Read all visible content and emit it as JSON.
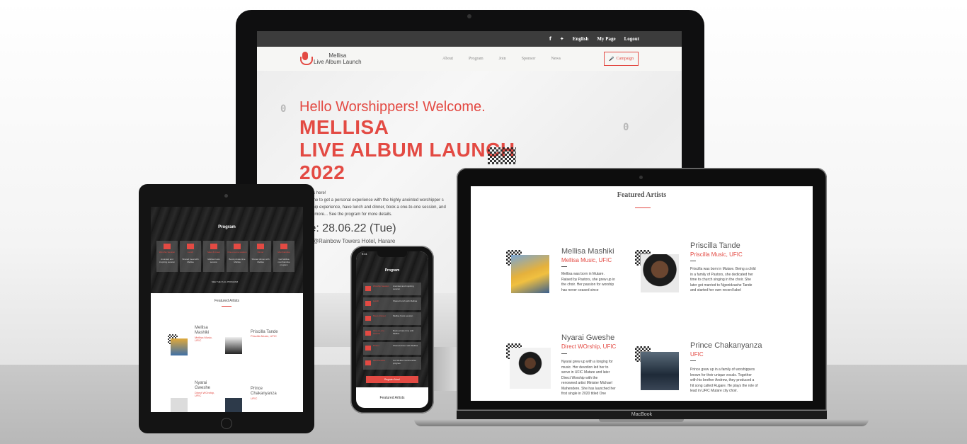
{
  "desktop": {
    "topbar": {
      "facebook_icon": "f",
      "twitter_icon": "🐦",
      "language": "English",
      "my_page": "My Page",
      "logout": "Logout"
    },
    "brand": {
      "line1": "Mellisa",
      "line2": "Live Album Launch",
      "icon": "microphone-icon"
    },
    "nav": [
      "About",
      "Program",
      "Join",
      "Sponsor",
      "News"
    ],
    "campaign_button": "Campaign",
    "hero": {
      "greeting": "Hello Worshippers! Welcome.",
      "title_line1": "MELLISA",
      "title_line2": "LIVE ALBUM LAUNCH",
      "title_line3": "2022",
      "text_line1": "e it's here!",
      "text_line2": "e time to get a personal experience with the highly anointed worshipper s",
      "text_line3": "orship experience, have lunch and dinner, book a one-to-one session, and",
      "text_line4": "uch more... See the program for more details.",
      "date": "te: 28.06.22 (Tue)",
      "venue": "e: @Rainbow Towers Hotel, Harare",
      "counter_left": "0",
      "counter_right": "0"
    }
  },
  "tablet": {
    "program_title": "Program",
    "program_items": [
      {
        "label": "Worship Session",
        "text": "Anointed and inspiring session"
      },
      {
        "label": "Lunch",
        "text": "Shared meal with Mellisa"
      },
      {
        "label": "Meet & Greet",
        "text": "Mellisa hosts session"
      },
      {
        "label": "One-on-one session",
        "text": "Book private time Mellisa"
      },
      {
        "label": "Dinner",
        "text": "Shared dinner with Mellisa"
      },
      {
        "label": "Merchandise",
        "text": "Get Mellisa merchandise program"
      }
    ],
    "program_note": "SEE THE FULL PROGRAM",
    "featured_title": "Featured Artists",
    "artists": [
      {
        "name1": "Mellisa",
        "name2": "Mashiki",
        "role1": "Mellisa Music,",
        "role2": "UFIC"
      },
      {
        "name1": "Priscilla Tande",
        "name2": "",
        "role1": "Priscilla Music, UFIC",
        "role2": ""
      },
      {
        "name1": "Nyarai",
        "name2": "Gweshe",
        "role1": "Direct WOrship,",
        "role2": "UFIC"
      },
      {
        "name1": "Prince",
        "name2": "Chakanyanza",
        "role1": "UFIC",
        "role2": ""
      }
    ]
  },
  "phone": {
    "time": "9:41",
    "program_title": "Program",
    "program_items": [
      {
        "label": "Worship Session",
        "text": "Anointed and inspiring session"
      },
      {
        "label": "Lunch",
        "text": "Shared lunch with Mellisa"
      },
      {
        "label": "Meet & Greet",
        "text": "Mellisa hosts session"
      },
      {
        "label": "One-on-one session",
        "text": "Book private time with Mellisa"
      },
      {
        "label": "Dinner",
        "text": "Shared dinner with Mellisa"
      },
      {
        "label": "Merchandise",
        "text": "Get Mellisa merchandise program"
      }
    ],
    "register_button": "Register Now!",
    "featured_title": "Featured Artists"
  },
  "laptop": {
    "brand_label": "MacBook",
    "featured_title": "Featured Artists",
    "artists": [
      {
        "name": "Mellisa Mashiki",
        "role": "Mellisa Music, UFIC",
        "bio": [
          "Mellisa was born in Mutare.",
          "Raised by Pastors, she grew up in",
          "the choir. Her passion for worship",
          "has never ceased since"
        ]
      },
      {
        "name": "Priscilla Tande",
        "role": "Priscilla Music, UFIC",
        "bio": [
          "Priscilla was born in Mutare. Being a child",
          "in a family of Pastors, she dedicated her",
          "time to church singing in the choir. She",
          "later got married to Ngonidzashe Tande",
          "and started her own record label"
        ]
      },
      {
        "name": "Nyarai Gweshe",
        "role": "Direct WOrship, UFIC",
        "bio": [
          "Nyarai grew up with a longing for",
          "music. Her devotion led her to",
          "serve in UFIC Mutare and later",
          "Direct Worship with the",
          "renowned artist Minister Michael",
          "Mahendere. She has launched her",
          "first single in 2020 titled One"
        ]
      },
      {
        "name": "Prince Chakanyanza",
        "role": "UFIC",
        "bio": [
          "Prince grew up in a family of worshippers",
          "known for their unique vocals. Together",
          "with his brother Andrew, they produced a",
          "hit song called Rugare. He plays the role of",
          "lead in UFIC Mutare city choir."
        ]
      }
    ]
  },
  "colors": {
    "accent": "#e34a43",
    "dark": "#3c3c3c"
  }
}
